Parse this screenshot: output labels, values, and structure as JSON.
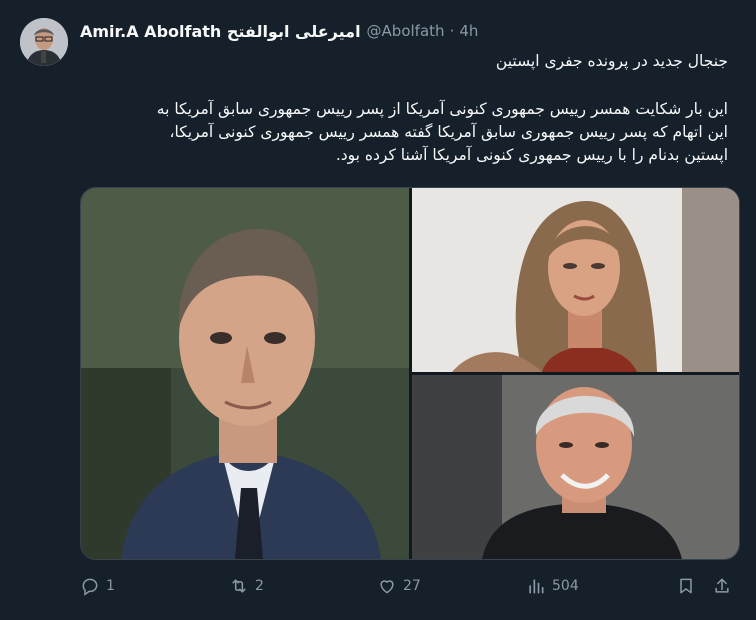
{
  "tweet": {
    "display_name": "Amir.A Abolfath امیرعلی ابوالفتح",
    "handle": "@Abolfath",
    "separator": "·",
    "time": "4h",
    "headline": "جنجال جدید در پرونده جفری اپستین",
    "body_lines": [
      "این بار شکایت همسر رییس جمهوری کنونی آمریکا از پسر رییس جمهوری سابق آمریکا به",
      "این اتهام که پسر رییس جمهوری سابق آمریکا گفته همسر رییس جمهوری کنونی آمریکا،",
      "اپستین بدنام را با رییس جمهوری کنونی آمریکا آشنا کرده بود."
    ]
  },
  "actions": {
    "replies": "1",
    "reposts": "2",
    "likes": "27",
    "views": "504"
  },
  "icons": {
    "reply": "reply-icon",
    "repost": "repost-icon",
    "like": "heart-icon",
    "views": "views-chart-icon",
    "bookmark": "bookmark-icon",
    "share": "share-icon"
  },
  "colors": {
    "background": "#15202b",
    "text": "#f7f9f9",
    "muted": "#8b98a5",
    "border": "#38444d"
  }
}
